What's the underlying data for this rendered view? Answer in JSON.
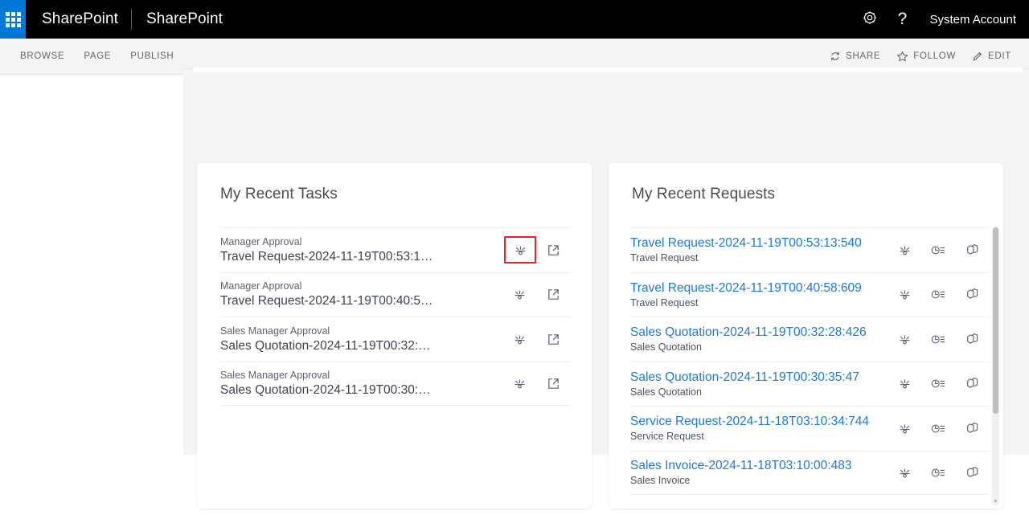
{
  "suitebar": {
    "waffle_label": "app-launcher",
    "brand": "SharePoint",
    "site": "SharePoint",
    "settings_icon": "gear-icon",
    "help_icon": "question-mark-icon",
    "help_glyph": "?",
    "user": "System Account"
  },
  "ribbon": {
    "tabs": [
      {
        "label": "BROWSE"
      },
      {
        "label": "PAGE"
      },
      {
        "label": "PUBLISH"
      }
    ],
    "actions": [
      {
        "label": "SHARE",
        "icon": "share-icon"
      },
      {
        "label": "FOLLOW",
        "icon": "star-icon"
      },
      {
        "label": "EDIT",
        "icon": "pencil-icon"
      }
    ]
  },
  "tasks_card": {
    "title": "My Recent Tasks",
    "rows": [
      {
        "stage": "Manager Approval",
        "title": "Travel Request-2024-11-19T00:53:1…",
        "workflow_icon": "workflow-diagram-icon",
        "open_icon": "open-in-new-window-icon",
        "highlighted": true
      },
      {
        "stage": "Manager Approval",
        "title": "Travel Request-2024-11-19T00:40:5…",
        "workflow_icon": "workflow-diagram-icon",
        "open_icon": "open-in-new-window-icon",
        "highlighted": false
      },
      {
        "stage": "Sales Manager Approval",
        "title": "Sales Quotation-2024-11-19T00:32:…",
        "workflow_icon": "workflow-diagram-icon",
        "open_icon": "open-in-new-window-icon",
        "highlighted": false
      },
      {
        "stage": "Sales Manager Approval",
        "title": "Sales Quotation-2024-11-19T00:30:…",
        "workflow_icon": "workflow-diagram-icon",
        "open_icon": "open-in-new-window-icon",
        "highlighted": false
      }
    ]
  },
  "requests_card": {
    "title": "My Recent Requests",
    "rows": [
      {
        "title": "Travel Request-2024-11-19T00:53:13:540",
        "type": "Travel Request",
        "workflow_icon": "workflow-diagram-icon",
        "history_icon": "history-clock-icon",
        "copy_icon": "copy-duplicate-icon"
      },
      {
        "title": "Travel Request-2024-11-19T00:40:58:609",
        "type": "Travel Request",
        "workflow_icon": "workflow-diagram-icon",
        "history_icon": "history-clock-icon",
        "copy_icon": "copy-duplicate-icon"
      },
      {
        "title": "Sales Quotation-2024-11-19T00:32:28:426",
        "type": "Sales Quotation",
        "workflow_icon": "workflow-diagram-icon",
        "history_icon": "history-clock-icon",
        "copy_icon": "copy-duplicate-icon"
      },
      {
        "title": "Sales Quotation-2024-11-19T00:30:35:47",
        "type": "Sales Quotation",
        "workflow_icon": "workflow-diagram-icon",
        "history_icon": "history-clock-icon",
        "copy_icon": "copy-duplicate-icon"
      },
      {
        "title": "Service Request-2024-11-18T03:10:34:744",
        "type": "Service Request",
        "workflow_icon": "workflow-diagram-icon",
        "history_icon": "history-clock-icon",
        "copy_icon": "copy-duplicate-icon"
      },
      {
        "title": "Sales Invoice-2024-11-18T03:10:00:483",
        "type": "Sales Invoice",
        "workflow_icon": "workflow-diagram-icon",
        "history_icon": "history-clock-icon",
        "copy_icon": "copy-duplicate-icon"
      }
    ],
    "scrollbar": {
      "name": "requests-scrollbar"
    }
  },
  "colors": {
    "suitebar_bg": "#000000",
    "waffle_bg": "#0078d7",
    "link": "#1a7ad9",
    "highlight_border": "#ee2222",
    "zone_bg": "#f4f5f7"
  }
}
